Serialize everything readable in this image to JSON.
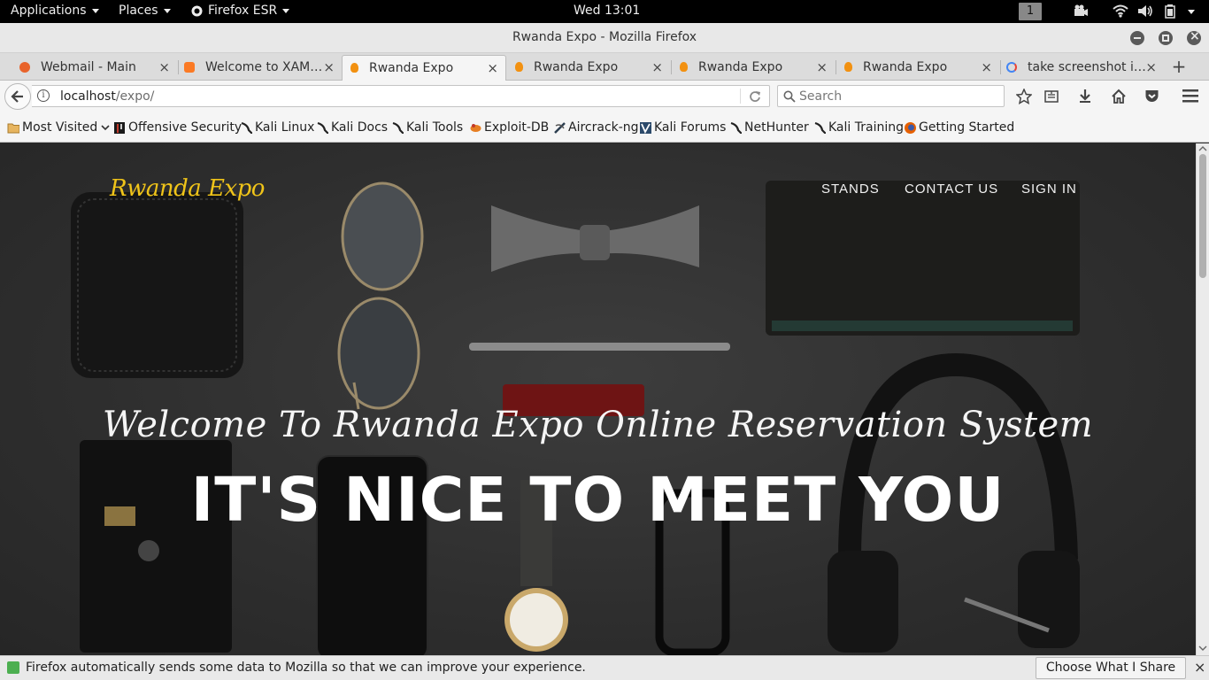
{
  "panel": {
    "applications": "Applications",
    "places": "Places",
    "app_name": "Firefox ESR",
    "clock": "Wed 13:01",
    "workspace": "1"
  },
  "window": {
    "title": "Rwanda Expo - Mozilla Firefox"
  },
  "tabs": [
    {
      "label": "Webmail - Main",
      "favicon_color": "#e8632b"
    },
    {
      "label": "Welcome to XAM…",
      "favicon_color": "#fb7a24"
    },
    {
      "label": "Rwanda Expo",
      "favicon_color": "#f29111"
    },
    {
      "label": "Rwanda Expo",
      "favicon_color": "#f29111"
    },
    {
      "label": "Rwanda Expo",
      "favicon_color": "#f29111"
    },
    {
      "label": "Rwanda Expo",
      "favicon_color": "#f29111"
    },
    {
      "label": "take screenshot i…",
      "favicon_color": "#4285f4"
    }
  ],
  "navbar": {
    "url_host": "localhost",
    "url_path": "/expo/",
    "search_placeholder": "Search"
  },
  "bookmarks": [
    {
      "label": "Most Visited"
    },
    {
      "label": "Offensive Security"
    },
    {
      "label": "Kali Linux"
    },
    {
      "label": "Kali Docs"
    },
    {
      "label": "Kali Tools"
    },
    {
      "label": "Exploit-DB"
    },
    {
      "label": "Aircrack-ng"
    },
    {
      "label": "Kali Forums"
    },
    {
      "label": "NetHunter"
    },
    {
      "label": "Kali Training"
    },
    {
      "label": "Getting Started"
    }
  ],
  "site": {
    "brand": "Rwanda Expo",
    "nav": [
      "STANDS",
      "CONTACT US",
      "SIGN IN"
    ],
    "welcome": "Welcome To Rwanda Expo Online Reservation System",
    "heading": "IT'S NICE TO MEET YOU",
    "brand_color": "#f0c419"
  },
  "notification": {
    "text": "Firefox automatically sends some data to Mozilla so that we can improve your experience.",
    "button": "Choose What I Share"
  }
}
